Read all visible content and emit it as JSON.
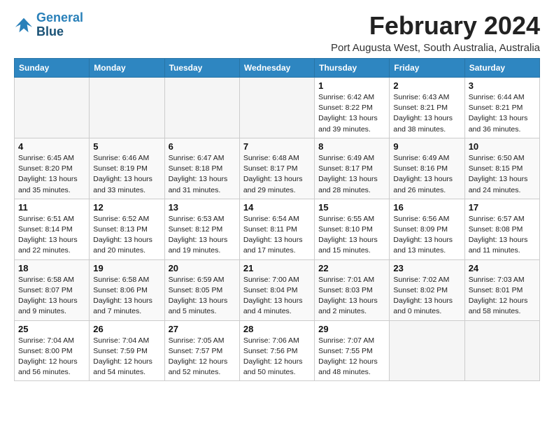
{
  "logo": {
    "line1": "General",
    "line2": "Blue"
  },
  "title": "February 2024",
  "subtitle": "Port Augusta West, South Australia, Australia",
  "days_of_week": [
    "Sunday",
    "Monday",
    "Tuesday",
    "Wednesday",
    "Thursday",
    "Friday",
    "Saturday"
  ],
  "weeks": [
    [
      {
        "day": "",
        "info": ""
      },
      {
        "day": "",
        "info": ""
      },
      {
        "day": "",
        "info": ""
      },
      {
        "day": "",
        "info": ""
      },
      {
        "day": "1",
        "info": "Sunrise: 6:42 AM\nSunset: 8:22 PM\nDaylight: 13 hours\nand 39 minutes."
      },
      {
        "day": "2",
        "info": "Sunrise: 6:43 AM\nSunset: 8:21 PM\nDaylight: 13 hours\nand 38 minutes."
      },
      {
        "day": "3",
        "info": "Sunrise: 6:44 AM\nSunset: 8:21 PM\nDaylight: 13 hours\nand 36 minutes."
      }
    ],
    [
      {
        "day": "4",
        "info": "Sunrise: 6:45 AM\nSunset: 8:20 PM\nDaylight: 13 hours\nand 35 minutes."
      },
      {
        "day": "5",
        "info": "Sunrise: 6:46 AM\nSunset: 8:19 PM\nDaylight: 13 hours\nand 33 minutes."
      },
      {
        "day": "6",
        "info": "Sunrise: 6:47 AM\nSunset: 8:18 PM\nDaylight: 13 hours\nand 31 minutes."
      },
      {
        "day": "7",
        "info": "Sunrise: 6:48 AM\nSunset: 8:17 PM\nDaylight: 13 hours\nand 29 minutes."
      },
      {
        "day": "8",
        "info": "Sunrise: 6:49 AM\nSunset: 8:17 PM\nDaylight: 13 hours\nand 28 minutes."
      },
      {
        "day": "9",
        "info": "Sunrise: 6:49 AM\nSunset: 8:16 PM\nDaylight: 13 hours\nand 26 minutes."
      },
      {
        "day": "10",
        "info": "Sunrise: 6:50 AM\nSunset: 8:15 PM\nDaylight: 13 hours\nand 24 minutes."
      }
    ],
    [
      {
        "day": "11",
        "info": "Sunrise: 6:51 AM\nSunset: 8:14 PM\nDaylight: 13 hours\nand 22 minutes."
      },
      {
        "day": "12",
        "info": "Sunrise: 6:52 AM\nSunset: 8:13 PM\nDaylight: 13 hours\nand 20 minutes."
      },
      {
        "day": "13",
        "info": "Sunrise: 6:53 AM\nSunset: 8:12 PM\nDaylight: 13 hours\nand 19 minutes."
      },
      {
        "day": "14",
        "info": "Sunrise: 6:54 AM\nSunset: 8:11 PM\nDaylight: 13 hours\nand 17 minutes."
      },
      {
        "day": "15",
        "info": "Sunrise: 6:55 AM\nSunset: 8:10 PM\nDaylight: 13 hours\nand 15 minutes."
      },
      {
        "day": "16",
        "info": "Sunrise: 6:56 AM\nSunset: 8:09 PM\nDaylight: 13 hours\nand 13 minutes."
      },
      {
        "day": "17",
        "info": "Sunrise: 6:57 AM\nSunset: 8:08 PM\nDaylight: 13 hours\nand 11 minutes."
      }
    ],
    [
      {
        "day": "18",
        "info": "Sunrise: 6:58 AM\nSunset: 8:07 PM\nDaylight: 13 hours\nand 9 minutes."
      },
      {
        "day": "19",
        "info": "Sunrise: 6:58 AM\nSunset: 8:06 PM\nDaylight: 13 hours\nand 7 minutes."
      },
      {
        "day": "20",
        "info": "Sunrise: 6:59 AM\nSunset: 8:05 PM\nDaylight: 13 hours\nand 5 minutes."
      },
      {
        "day": "21",
        "info": "Sunrise: 7:00 AM\nSunset: 8:04 PM\nDaylight: 13 hours\nand 4 minutes."
      },
      {
        "day": "22",
        "info": "Sunrise: 7:01 AM\nSunset: 8:03 PM\nDaylight: 13 hours\nand 2 minutes."
      },
      {
        "day": "23",
        "info": "Sunrise: 7:02 AM\nSunset: 8:02 PM\nDaylight: 13 hours\nand 0 minutes."
      },
      {
        "day": "24",
        "info": "Sunrise: 7:03 AM\nSunset: 8:01 PM\nDaylight: 12 hours\nand 58 minutes."
      }
    ],
    [
      {
        "day": "25",
        "info": "Sunrise: 7:04 AM\nSunset: 8:00 PM\nDaylight: 12 hours\nand 56 minutes."
      },
      {
        "day": "26",
        "info": "Sunrise: 7:04 AM\nSunset: 7:59 PM\nDaylight: 12 hours\nand 54 minutes."
      },
      {
        "day": "27",
        "info": "Sunrise: 7:05 AM\nSunset: 7:57 PM\nDaylight: 12 hours\nand 52 minutes."
      },
      {
        "day": "28",
        "info": "Sunrise: 7:06 AM\nSunset: 7:56 PM\nDaylight: 12 hours\nand 50 minutes."
      },
      {
        "day": "29",
        "info": "Sunrise: 7:07 AM\nSunset: 7:55 PM\nDaylight: 12 hours\nand 48 minutes."
      },
      {
        "day": "",
        "info": ""
      },
      {
        "day": "",
        "info": ""
      }
    ]
  ]
}
